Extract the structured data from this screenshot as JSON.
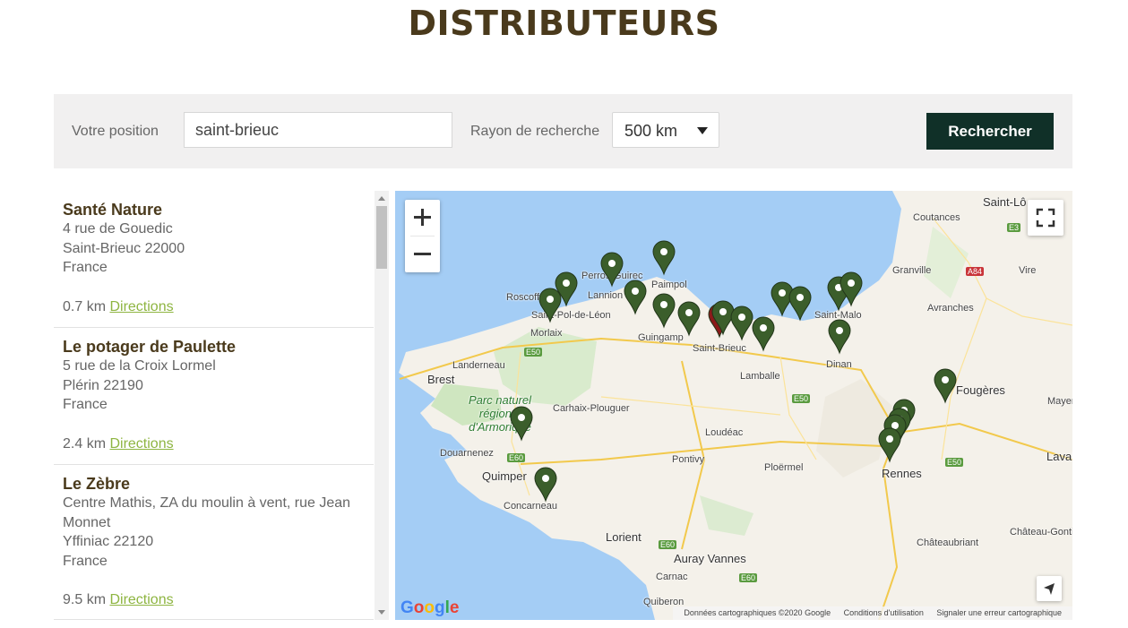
{
  "page": {
    "title": "DISTRIBUTEURS"
  },
  "search": {
    "position_label": "Votre position",
    "position_value": "saint-brieuc",
    "radius_label": "Rayon de recherche",
    "radius_value": "500 km",
    "button_label": "Rechercher"
  },
  "results": [
    {
      "name": "Santé Nature",
      "address": [
        "4 rue de Gouedic",
        "Saint-Brieuc 22000",
        "France"
      ],
      "distance": "0.7 km",
      "link": "Directions"
    },
    {
      "name": "Le potager de Paulette",
      "address": [
        "5 rue de la Croix Lormel",
        "Plérin 22190",
        "France"
      ],
      "distance": "2.4 km",
      "link": "Directions"
    },
    {
      "name": "Le Zèbre",
      "address": [
        "Centre Mathis, ZA du moulin à vent, rue Jean",
        "Monnet",
        "Yffiniac 22120",
        "France"
      ],
      "distance": "9.5 km",
      "link": "Directions"
    }
  ],
  "map": {
    "zoom_in_label": "+",
    "zoom_out_label": "−",
    "google_logo": "Google",
    "attribution": [
      "Données cartographiques ©2020 Google",
      "Conditions d'utilisation",
      "Signaler une erreur cartographique"
    ],
    "icons": [
      "zoom-in-icon",
      "zoom-out-icon",
      "fullscreen-icon",
      "my-location-icon",
      "map-marker-icon"
    ],
    "marker_color": "#3b5e2b",
    "selected_marker_color": "#8b1a1a",
    "places": {
      "saint_lo": "Saint-Lô",
      "coutances": "Coutances",
      "granville": "Granville",
      "vire": "Vire",
      "avranches": "Avranches",
      "saint_malo": "Saint-Malo",
      "perros": "Perros-Guirec",
      "lannion": "Lannion",
      "paimpol": "Paimpol",
      "roscoff": "Roscoff",
      "saint_pol": "Saint-Pol-de-Léon",
      "morlaix": "Morlaix",
      "guingamp": "Guingamp",
      "saint_brieuc": "Saint-Brieuc",
      "lamballe": "Lamballe",
      "dinan": "Dinan",
      "brest": "Brest",
      "landerneau": "Landerneau",
      "park": "Parc naturel régional d'Armorique",
      "carhaix": "Carhaix-Plouguer",
      "loudeac": "Loudéac",
      "fougeres": "Fougères",
      "mayenne": "Mayenne",
      "douarnenez": "Douarnenez",
      "quimper": "Quimper",
      "pontivy": "Pontivy",
      "rennes": "Rennes",
      "laval": "Laval",
      "concarneau": "Concarneau",
      "ploermel": "Ploërmel",
      "lorient": "Lorient",
      "chateau_gontier": "Château-Gontier-s",
      "auray_vannes": "Auray Vannes",
      "chateaubriant": "Châteaubriant",
      "carnac": "Carnac",
      "quiberon": "Quiberon"
    },
    "roads": {
      "e3": "E3",
      "a84": "A84",
      "e50a": "E50",
      "e50b": "E50",
      "e50c": "E50",
      "e60a": "E60",
      "e60b": "E60",
      "e60c": "E60"
    }
  }
}
